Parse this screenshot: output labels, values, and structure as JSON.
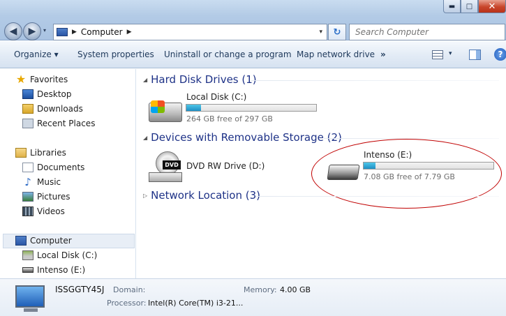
{
  "window": {
    "controls": {
      "minimize": "▬",
      "maximize": "□",
      "close": "✕"
    }
  },
  "nav": {
    "back_glyph": "◀",
    "forward_glyph": "▶",
    "history_glyph": "▾",
    "address": {
      "location": "Computer",
      "separator": "▶",
      "drop_glyph": "▾"
    },
    "refresh_glyph": "↻",
    "search_placeholder": "Search Computer"
  },
  "toolbar": {
    "organize": "Organize ▾",
    "system_properties": "System properties",
    "uninstall": "Uninstall or change a program",
    "map_drive": "Map network drive",
    "more": "»",
    "view_drop": "▾",
    "help": "?"
  },
  "sidebar": {
    "favorites": {
      "label": "Favorites",
      "items": [
        {
          "label": "Desktop",
          "icon": "desktop-icon"
        },
        {
          "label": "Downloads",
          "icon": "downloads-icon"
        },
        {
          "label": "Recent Places",
          "icon": "recent-places-icon"
        }
      ]
    },
    "libraries": {
      "label": "Libraries",
      "items": [
        {
          "label": "Documents",
          "icon": "documents-icon"
        },
        {
          "label": "Music",
          "icon": "music-icon"
        },
        {
          "label": "Pictures",
          "icon": "pictures-icon"
        },
        {
          "label": "Videos",
          "icon": "videos-icon"
        }
      ]
    },
    "computer": {
      "label": "Computer",
      "items": [
        {
          "label": "Local Disk (C:)",
          "icon": "hard-disk-icon"
        },
        {
          "label": "Intenso (E:)",
          "icon": "usb-drive-icon"
        }
      ]
    }
  },
  "groups": {
    "hard_disk": {
      "title": "Hard Disk Drives (1)",
      "drives": [
        {
          "name": "Local Disk (C:)",
          "free": "264 GB free of 297 GB",
          "used_fraction": 0.111
        }
      ]
    },
    "removable": {
      "title": "Devices with Removable Storage (2)",
      "drives": [
        {
          "name": "DVD RW Drive (D:)",
          "icon_label": "DVD"
        },
        {
          "name": "Intenso (E:)",
          "free": "7.08 GB free of 7.79 GB",
          "used_fraction": 0.091
        }
      ]
    },
    "network": {
      "title": "Network Location (3)"
    }
  },
  "details": {
    "name": "ISSGGTY45J",
    "domain_label": "Domain:",
    "memory_label": "Memory:",
    "memory_value": "4.00 GB",
    "processor_label": "Processor:",
    "processor_value": "Intel(R) Core(TM) i3-21..."
  },
  "colors": {
    "group_header": "#1e3287",
    "bar_fill": "#1e8fc4",
    "annotation": "#c00000"
  }
}
